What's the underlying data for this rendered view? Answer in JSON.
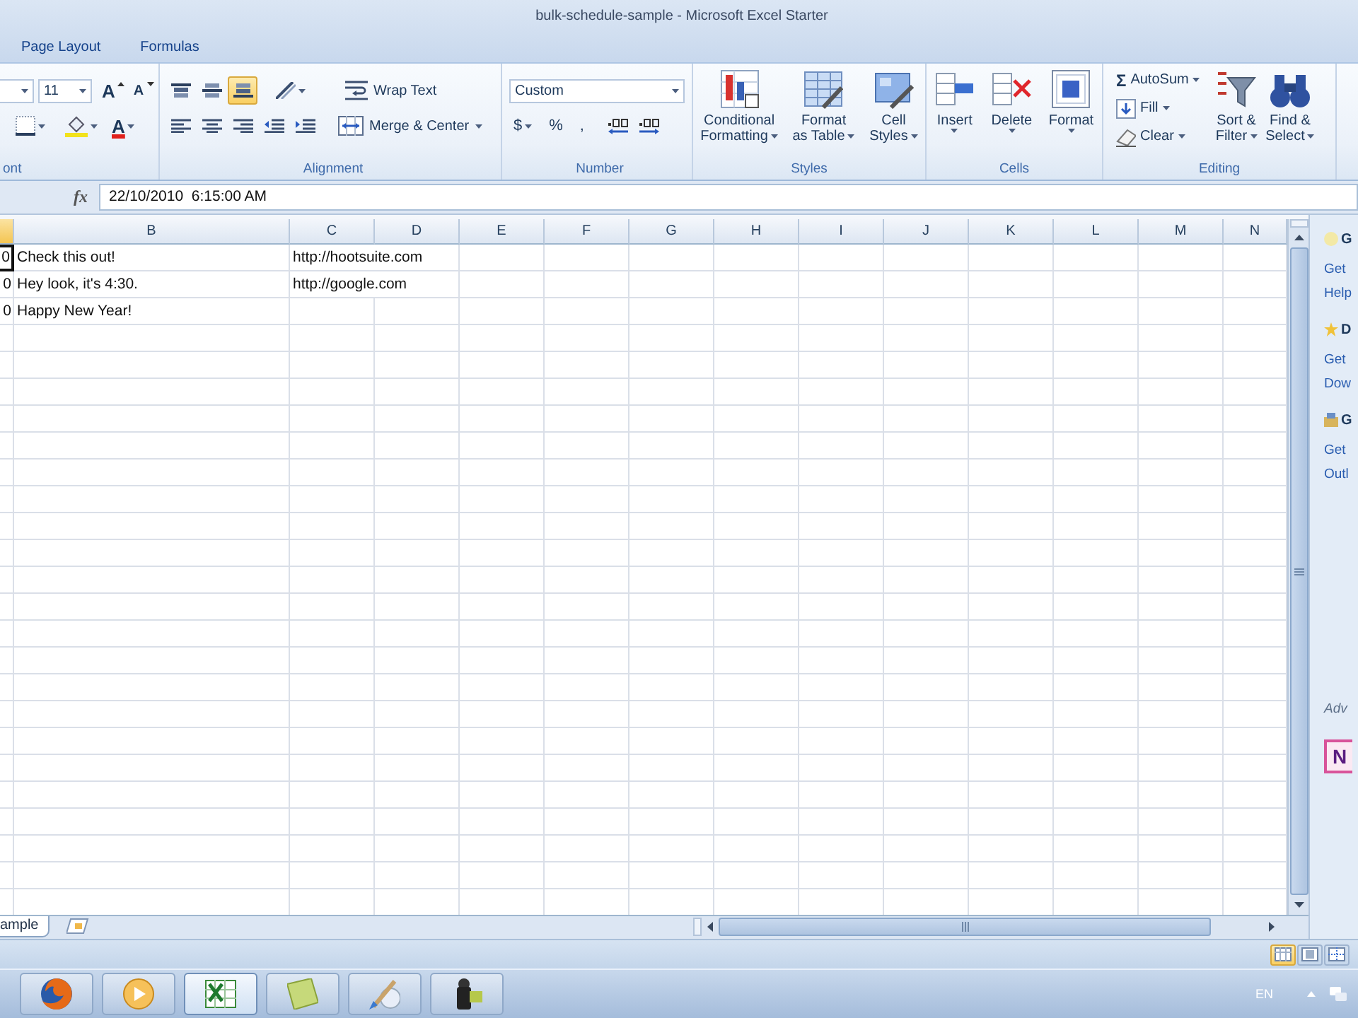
{
  "window": {
    "title": "bulk-schedule-sample - Microsoft Excel Starter"
  },
  "ribbon_tabs": [
    {
      "label": "Page Layout",
      "selected": false
    },
    {
      "label": "Formulas",
      "selected": false
    }
  ],
  "ribbon": {
    "groups": [
      {
        "kind": "font",
        "label": "ont",
        "font_size": "11",
        "grow_glyph": "A",
        "shrink_glyph": "A",
        "font_color_glyph": "A"
      },
      {
        "kind": "alignment",
        "label": "Alignment",
        "vertical_align": [
          {
            "selected": false
          },
          {
            "selected": false
          },
          {
            "selected": true
          }
        ],
        "wrap_text": "Wrap Text",
        "merge": "Merge & Center"
      },
      {
        "kind": "number",
        "label": "Number",
        "format": "Custom",
        "currency": "$",
        "percent": "%",
        "comma": ","
      },
      {
        "kind": "styles",
        "label": "Styles",
        "buttons": [
          {
            "lines": [
              "Conditional",
              "Formatting"
            ],
            "dropdown": true
          },
          {
            "lines": [
              "Format",
              "as Table"
            ],
            "dropdown": true
          },
          {
            "lines": [
              "Cell",
              "Styles"
            ],
            "dropdown": true
          }
        ]
      },
      {
        "kind": "cells",
        "label": "Cells",
        "buttons": [
          {
            "lines": [
              "Insert"
            ],
            "dropdown": true
          },
          {
            "lines": [
              "Delete"
            ],
            "dropdown": true
          },
          {
            "lines": [
              "Format"
            ],
            "dropdown": true
          }
        ]
      },
      {
        "kind": "editing",
        "label": "Editing",
        "small_buttons": [
          {
            "glyph": "Σ",
            "label": "AutoSum",
            "dropdown": true
          },
          {
            "label": "Fill",
            "dropdown": true
          },
          {
            "label": "Clear",
            "dropdown": true
          }
        ],
        "buttons": [
          {
            "lines": [
              "Sort &",
              "Filter"
            ],
            "dropdown": true
          },
          {
            "lines": [
              "Find &",
              "Select"
            ],
            "dropdown": true
          }
        ]
      }
    ]
  },
  "formula_bar": {
    "function_label": "fx",
    "value": "22/10/2010  6:15:00 AM"
  },
  "sheet": {
    "columns": [
      {
        "selected": true
      },
      {
        "label": "B",
        "selected": false
      },
      {
        "label": "C",
        "selected": false
      },
      {
        "label": "D",
        "selected": false
      },
      {
        "label": "E",
        "selected": false
      },
      {
        "label": "F",
        "selected": false
      },
      {
        "label": "G",
        "selected": false
      },
      {
        "label": "H",
        "selected": false
      },
      {
        "label": "I",
        "selected": false
      },
      {
        "label": "J",
        "selected": false
      },
      {
        "label": "K",
        "selected": false
      },
      {
        "label": "L",
        "selected": false
      },
      {
        "label": "M",
        "selected": false
      },
      {
        "label": "N",
        "selected": false
      }
    ],
    "rows": [
      {
        "cells": [
          {
            "text": "0",
            "selected": true
          },
          {
            "text": "Check this out!",
            "selected": false
          },
          {
            "text": "http://hootsuite.com",
            "selected": false
          }
        ]
      },
      {
        "cells": [
          {
            "text": "0",
            "selected": false
          },
          {
            "text": "Hey look, it's 4:30.",
            "selected": false
          },
          {
            "text": "http://google.com",
            "selected": false
          }
        ]
      },
      {
        "cells": [
          {
            "text": "0",
            "selected": false
          },
          {
            "text": "Happy New Year!",
            "selected": false
          }
        ]
      }
    ]
  },
  "sheet_tabs": [
    {
      "label": "ample",
      "selected": true
    }
  ],
  "task_pane": {
    "sections": [
      {
        "heading": "G",
        "links": [
          "Get",
          "Help"
        ]
      },
      {
        "heading": "D",
        "links": [
          "Get",
          "Dow"
        ]
      },
      {
        "heading": "G",
        "links": [
          "Get",
          "Outl"
        ]
      }
    ],
    "ad_label": "Adv",
    "ad_logo": "N"
  },
  "status_bar": {
    "view_buttons": [
      {
        "selected": true
      },
      {
        "selected": false
      },
      {
        "selected": false
      }
    ]
  },
  "taskbar": {
    "buttons": [
      {
        "selected": false
      },
      {
        "selected": false
      },
      {
        "selected": true
      },
      {
        "selected": false
      },
      {
        "selected": false
      },
      {
        "selected": false
      }
    ],
    "language": "EN"
  }
}
